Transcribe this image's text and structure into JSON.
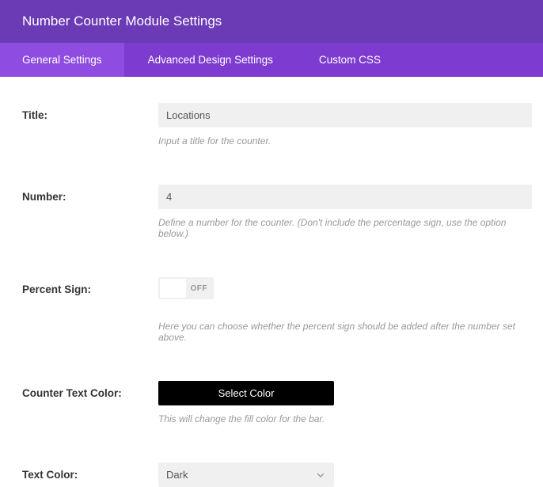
{
  "header": {
    "title": "Number Counter Module Settings"
  },
  "tabs": [
    {
      "label": "General Settings"
    },
    {
      "label": "Advanced Design Settings"
    },
    {
      "label": "Custom CSS"
    }
  ],
  "fields": {
    "title": {
      "label": "Title:",
      "value": "Locations",
      "helper": "Input a title for the counter."
    },
    "number": {
      "label": "Number:",
      "value": "4",
      "helper": "Define a number for the counter. (Don't include the percentage sign, use the option below.)"
    },
    "percent": {
      "label": "Percent Sign:",
      "state": "OFF",
      "helper": "Here you can choose whether the percent sign should be added after the number set above."
    },
    "counter_color": {
      "label": "Counter Text Color:",
      "button": "Select Color",
      "helper": "This will change the fill color for the bar."
    },
    "text_color": {
      "label": "Text Color:",
      "value": "Dark"
    }
  }
}
